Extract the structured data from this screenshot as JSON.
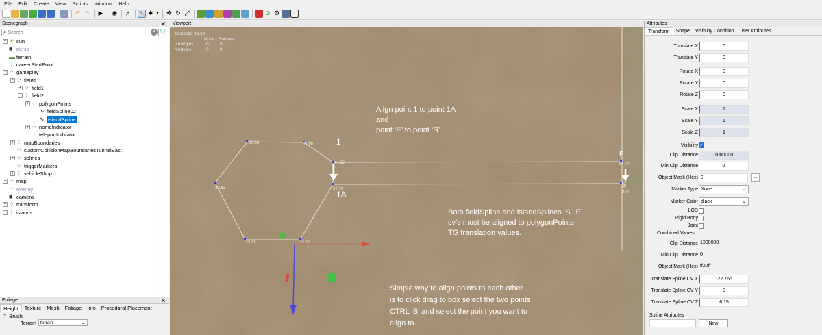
{
  "menu": [
    "File",
    "Edit",
    "Create",
    "View",
    "Scripts",
    "Window",
    "Help"
  ],
  "scenegraph": {
    "title": "Scenegraph",
    "search_placeholder": "Search",
    "nodes": [
      {
        "label": "sun",
        "depth": 0,
        "icon": "sun-icon",
        "expander": "+"
      },
      {
        "label": "persp",
        "depth": 0,
        "icon": "camera-icon",
        "expander": "",
        "dim": true
      },
      {
        "label": "terrain",
        "depth": 0,
        "icon": "terrain-icon",
        "expander": ""
      },
      {
        "label": "careerStartPoint",
        "depth": 0,
        "icon": "group-icon",
        "expander": ""
      },
      {
        "label": "gameplay",
        "depth": 0,
        "icon": "group-icon",
        "expander": "-"
      },
      {
        "label": "fields",
        "depth": 1,
        "icon": "group-icon",
        "expander": "-"
      },
      {
        "label": "field1",
        "depth": 2,
        "icon": "group-icon",
        "expander": "+"
      },
      {
        "label": "field2",
        "depth": 2,
        "icon": "group-icon",
        "expander": "-"
      },
      {
        "label": "polygonPoints",
        "depth": 3,
        "icon": "group-icon",
        "expander": "+"
      },
      {
        "label": "fieldSpline02",
        "depth": 4,
        "icon": "spline-icon",
        "expander": ""
      },
      {
        "label": "islandSpline",
        "depth": 4,
        "icon": "spline-icon",
        "expander": "",
        "selected": true
      },
      {
        "label": "nameIndicator",
        "depth": 3,
        "icon": "group-icon",
        "expander": "+"
      },
      {
        "label": "teleportIndicator",
        "depth": 3,
        "icon": "group-icon",
        "expander": ""
      },
      {
        "label": "mapBoundaries",
        "depth": 1,
        "icon": "boundary-icon",
        "expander": "+"
      },
      {
        "label": "customCollisionMapBoundariesTunnelEast",
        "depth": 1,
        "icon": "cube-icon",
        "expander": ""
      },
      {
        "label": "splines",
        "depth": 1,
        "icon": "group-icon",
        "expander": "+"
      },
      {
        "label": "triggerMarkers",
        "depth": 1,
        "icon": "group-icon",
        "expander": ""
      },
      {
        "label": "vehicleShop",
        "depth": 1,
        "icon": "group-icon",
        "expander": "+"
      },
      {
        "label": "map",
        "depth": 0,
        "icon": "group-icon",
        "expander": "+"
      },
      {
        "label": "overlay",
        "depth": 0,
        "icon": "overlay-icon",
        "expander": "",
        "dim": true
      },
      {
        "label": "camera",
        "depth": 0,
        "icon": "camera-icon",
        "expander": ""
      },
      {
        "label": "transform",
        "depth": 0,
        "icon": "group-icon",
        "expander": "+"
      },
      {
        "label": "islands",
        "depth": 0,
        "icon": "group-icon",
        "expander": "+"
      }
    ]
  },
  "foliage": {
    "title": "Foliage",
    "tabs": [
      "Height",
      "Texture",
      "Mesh",
      "Foliage",
      "Info",
      "Procedural Placement"
    ],
    "section": "Brush",
    "terrain_label": "Terrain",
    "terrain_value": "terrain"
  },
  "viewport": {
    "title": "Viewport",
    "stats": {
      "distance": "Distance 38.39",
      "col1": "Node",
      "col2": "Subtree",
      "triangles_label": "Triangles",
      "triangles_node": "0",
      "triangles_subtree": "0",
      "vertices_label": "Vertices",
      "vertices_node": "0",
      "vertices_subtree": "0"
    },
    "point_labels": [
      "37.66",
      "41.66",
      "44.22",
      "33.63",
      "20.79",
      "29.21",
      "25.32",
      "64.??",
      "0.00"
    ],
    "marker_1": "1",
    "marker_1a": "1A",
    "marker_e": "E",
    "marker_s": "S",
    "note1": [
      "Align point 1 to point 1A",
      "and",
      "point ‘E’ to point ‘S’"
    ],
    "note2": [
      "Both fieldSpline and islandSplines ‘S’,’E’",
      "cv’s must be aligned to polygonPoints",
      "TG translation values."
    ],
    "note3": [
      "Simple way to align points to each other",
      "is to click drag to box select the two points",
      "CTRL ‘B’ and select the point you want to",
      "align to."
    ]
  },
  "attributes": {
    "title": "Attributes",
    "tabs": [
      "Transform",
      "Shape",
      "Visibility Condition",
      "User Attributes"
    ],
    "translate_x_label": "Translate X",
    "translate_x": "0",
    "translate_y_label": "Translate Y",
    "translate_y": "0",
    "rotate_x_label": "Rotate X",
    "rotate_x": "0",
    "rotate_y_label": "Rotate Y",
    "rotate_y": "0",
    "rotate_z_label": "Rotate Z",
    "rotate_z": "0",
    "scale_x_label": "Scale X",
    "scale_x": "1",
    "scale_y_label": "Scale Y",
    "scale_y": "1",
    "scale_z_label": "Scale Z",
    "scale_z": "1",
    "visibility_label": "Visibility",
    "clip_distance_label": "Clip Distance",
    "clip_distance": "1000000",
    "min_clip_distance_label": "Min Clip Distance",
    "min_clip_distance": "0",
    "object_mask_label": "Object Mask (Hex)",
    "object_mask": "0",
    "more_button": "...",
    "marker_type_label": "Marker Type",
    "marker_type": "None",
    "marker_color_label": "Marker Color",
    "marker_color": "black",
    "lod_label": "LOD",
    "rigid_body_label": "Rigid Body",
    "joint_label": "Joint",
    "combined_values_label": "Combined Values",
    "c_clip_distance_label": "Clip Distance",
    "c_clip_distance": "1000000",
    "c_min_clip_distance_label": "Min Clip Distance",
    "c_min_clip_distance": "0",
    "c_object_mask_label": "Object Mask (Hex)",
    "c_object_mask": "ff00ff",
    "spline_cv_x_label": "Translate Spline CV X",
    "spline_cv_x": "-22.765",
    "spline_cv_y_label": "Translate Spline CV Y",
    "spline_cv_y": "0",
    "spline_cv_z_label": "Translate Spline CV Z",
    "spline_cv_z": "6.15",
    "spline_attributes_label": "Spline Attributes",
    "new_button": "New"
  }
}
